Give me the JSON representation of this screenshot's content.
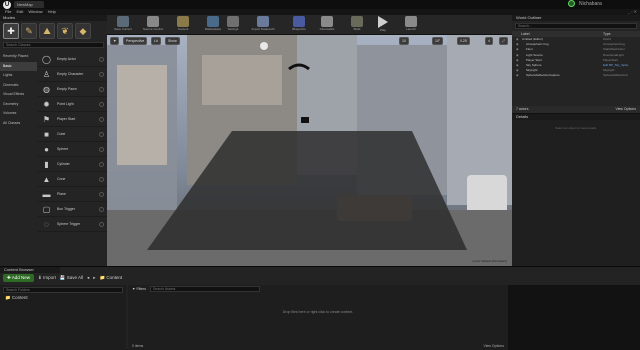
{
  "title_bar": {
    "logo": "U",
    "tab": "NewMap",
    "user": "Nichabara"
  },
  "menu": [
    "File",
    "Edit",
    "Window",
    "Help"
  ],
  "window_controls": "_ ▫ ✕",
  "modes": {
    "title": "Modes",
    "search_placeholder": "Search Classes",
    "categories": [
      "Recently Placed",
      "Basic",
      "Lights",
      "Cinematic",
      "Visual Effects",
      "Geometry",
      "Volumes",
      "All Classes"
    ],
    "items": [
      {
        "label": "Empty Actor",
        "icon": "◯"
      },
      {
        "label": "Empty Character",
        "icon": "♙"
      },
      {
        "label": "Empty Pawn",
        "icon": "◍"
      },
      {
        "label": "Point Light",
        "icon": "✹"
      },
      {
        "label": "Player Start",
        "icon": "⚑"
      },
      {
        "label": "Cube",
        "icon": "■"
      },
      {
        "label": "Sphere",
        "icon": "●"
      },
      {
        "label": "Cylinder",
        "icon": "▮"
      },
      {
        "label": "Cone",
        "icon": "▲"
      },
      {
        "label": "Plane",
        "icon": "▬"
      },
      {
        "label": "Box Trigger",
        "icon": "▢"
      },
      {
        "label": "Sphere Trigger",
        "icon": "◌"
      }
    ]
  },
  "toolbar": [
    {
      "label": "Save Current",
      "color": "#5a6a78"
    },
    {
      "label": "Source Control",
      "color": "#888888"
    },
    {
      "label": "Content",
      "color": "#8a7a4a"
    },
    {
      "label": "Marketplace",
      "color": "#4a6a8a"
    },
    {
      "label": "Settings",
      "color": "#707070"
    },
    {
      "label": "Import Datasmith",
      "color": "#6a7a9a"
    },
    {
      "label": "Blueprints",
      "color": "#4a5aa0"
    },
    {
      "label": "Cinematics",
      "color": "#8a8a8a"
    },
    {
      "label": "Build",
      "color": "#6a6a5a"
    },
    {
      "label": "Play",
      "color": "#cfcfcf"
    },
    {
      "label": "Launch",
      "color": "#8a8a8a"
    }
  ],
  "viewport": {
    "perspective": "Perspective",
    "lit": "Lit",
    "show": "Show",
    "grid": "10",
    "angle": "10°",
    "scale": "0.25",
    "cam": "4",
    "watermark": "Level: Default (Persistent)"
  },
  "outliner": {
    "title": "World Outliner",
    "search_placeholder": "Search...",
    "col_label": "Label",
    "col_type": "Type",
    "rows": [
      {
        "label": "Untitled (Editor)",
        "type": "World",
        "indent": 0,
        "link": false
      },
      {
        "label": "Atmospheric Fog",
        "type": "AtmosphericFog",
        "indent": 1,
        "link": false
      },
      {
        "label": "Floor",
        "type": "StaticMeshActor",
        "indent": 1,
        "link": false
      },
      {
        "label": "Light Source",
        "type": "DirectionalLight",
        "indent": 1,
        "link": false
      },
      {
        "label": "Player Start",
        "type": "PlayerStart",
        "indent": 1,
        "link": false
      },
      {
        "label": "Sky Sphere",
        "type": "Edit BP_Sky_Sphe",
        "indent": 1,
        "link": true
      },
      {
        "label": "SkyLight",
        "type": "SkyLight",
        "indent": 1,
        "link": false
      },
      {
        "label": "SphereReflectionCapture",
        "type": "SphereReflectionC",
        "indent": 1,
        "link": false
      }
    ],
    "count": "7 actors",
    "view_options": "View Options"
  },
  "details": {
    "title": "Details",
    "empty_text": "Select an object to view details."
  },
  "content_browser": {
    "tab": "Content Browser",
    "add_new": "Add New",
    "import": "Import",
    "save_all": "Save All",
    "path": "Content",
    "search_folders": "Search Folders",
    "tree": [
      "Content"
    ],
    "filters": "Filters",
    "search_assets": "Search Assets",
    "empty": "Drop files here or right click to create content.",
    "count": "0 items",
    "view_options": "View Options"
  }
}
